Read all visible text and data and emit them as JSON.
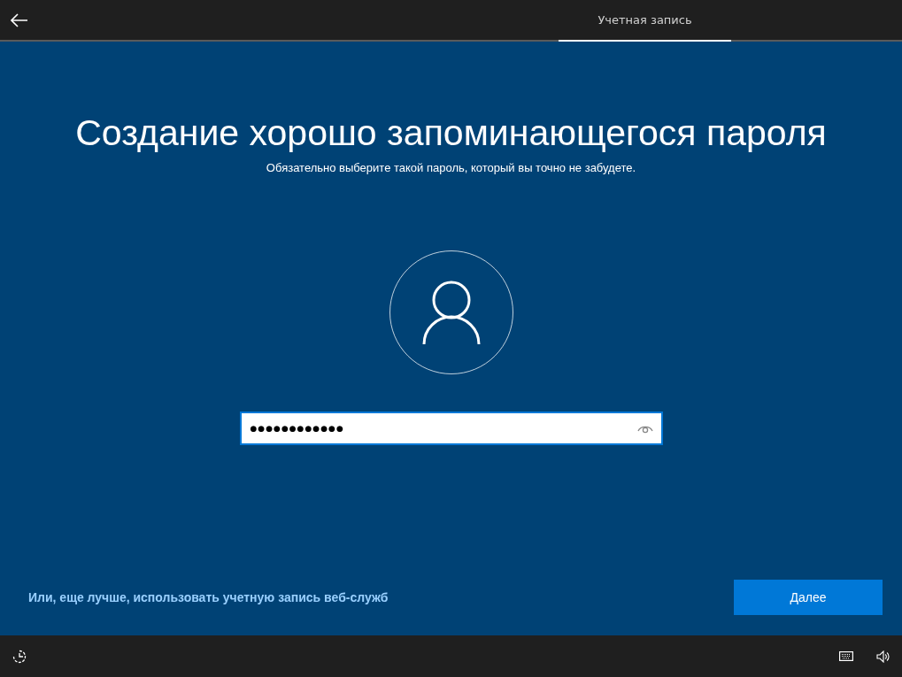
{
  "top_bar": {
    "tabs": [
      {
        "label": "Учетная запись",
        "selected": true
      }
    ]
  },
  "title": "Создание хорошо запоминающегося пароля",
  "subtitle": "Обязательно выберите такой пароль, который вы точно не забудете.",
  "password_field": {
    "value": "●●●●●●●●●●●●",
    "focused": true
  },
  "link": "Или, еще лучше, использовать учетную запись веб-служб",
  "next_button": "Далее"
}
